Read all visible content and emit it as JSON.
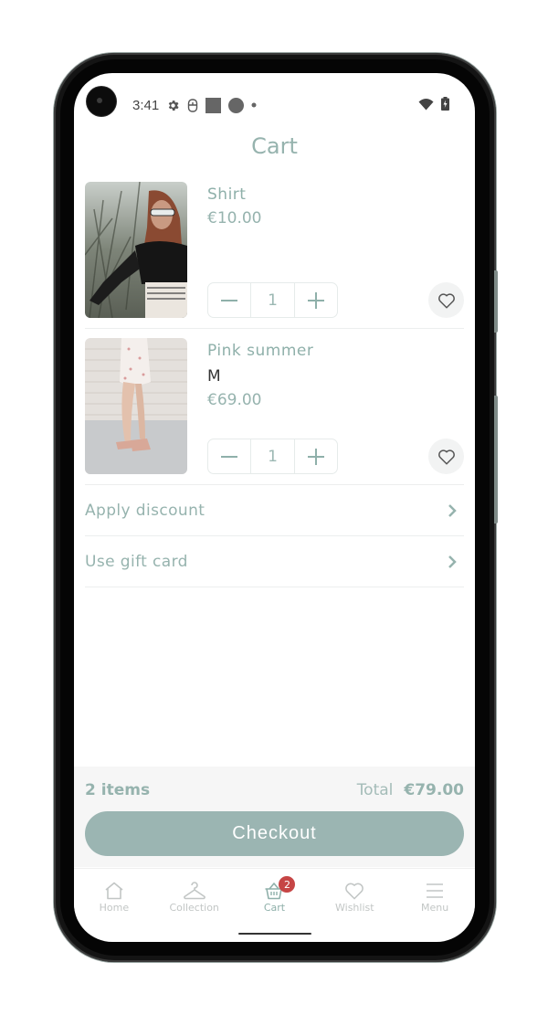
{
  "status_bar": {
    "time": "3:41",
    "icons_left": [
      "settings-icon",
      "sim-icon",
      "square-notification-icon",
      "circle-notification-icon",
      "dot-icon"
    ],
    "icons_right": [
      "wifi-icon",
      "battery-charging-icon"
    ]
  },
  "header": {
    "title": "Cart"
  },
  "cart": {
    "items": [
      {
        "name": "Shirt",
        "variant": "",
        "price": "€10.00",
        "quantity": "1",
        "image": "woman-in-black-top-photo"
      },
      {
        "name": "Pink summer",
        "variant": "M",
        "price": "€69.00",
        "quantity": "1",
        "image": "floral-dress-photo"
      }
    ],
    "links": [
      {
        "label": "Apply discount"
      },
      {
        "label": "Use gift card"
      }
    ]
  },
  "summary": {
    "count_label": "2 items",
    "total_label": "Total",
    "total_value": "€79.00",
    "checkout_label": "Checkout"
  },
  "tabbar": {
    "tabs": [
      {
        "label": "Home",
        "icon": "home-icon",
        "active": false
      },
      {
        "label": "Collection",
        "icon": "hanger-icon",
        "active": false
      },
      {
        "label": "Cart",
        "icon": "basket-icon",
        "active": true,
        "badge": "2"
      },
      {
        "label": "Wishlist",
        "icon": "heart-icon",
        "active": false
      },
      {
        "label": "Menu",
        "icon": "menu-icon",
        "active": false
      }
    ]
  },
  "colors": {
    "accent": "#96b3ae",
    "button": "#9bb5b2",
    "badge": "#c64545",
    "summary_bg": "#f6f6f6"
  }
}
